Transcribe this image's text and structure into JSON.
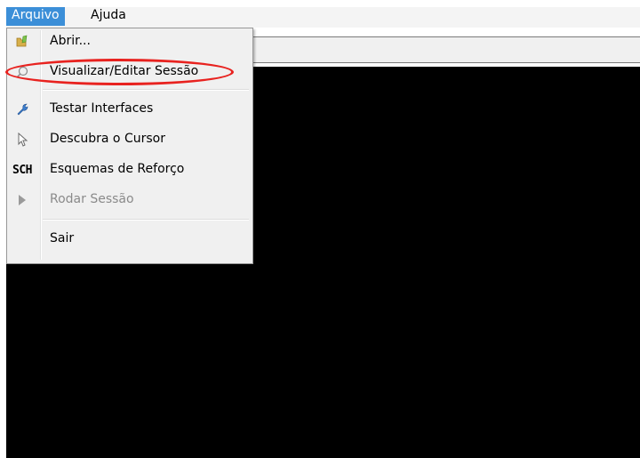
{
  "menubar": {
    "items": [
      {
        "label": "Arquivo"
      },
      {
        "label": "Ajuda"
      }
    ]
  },
  "file_menu": {
    "items": [
      {
        "label": "Abrir...",
        "icon": "folder-open-icon",
        "enabled": true
      },
      {
        "label": "Visualizar/Editar Sessão",
        "icon": "magnifier-icon",
        "enabled": true
      },
      {
        "label": "Testar Interfaces",
        "icon": "wrench-icon",
        "enabled": true
      },
      {
        "label": "Descubra o Cursor",
        "icon": "cursor-arrow-icon",
        "enabled": true
      },
      {
        "label": "Esquemas de Reforço",
        "icon": "sch-icon",
        "icon_text": "SCH",
        "enabled": true
      },
      {
        "label": "Rodar Sessão",
        "icon": "play-icon",
        "enabled": false
      },
      {
        "label": "Sair",
        "icon": "",
        "enabled": true
      }
    ]
  },
  "colors": {
    "menu_active": "#3c8fd8",
    "annotation": "#e8221f",
    "screen": "#000000"
  }
}
